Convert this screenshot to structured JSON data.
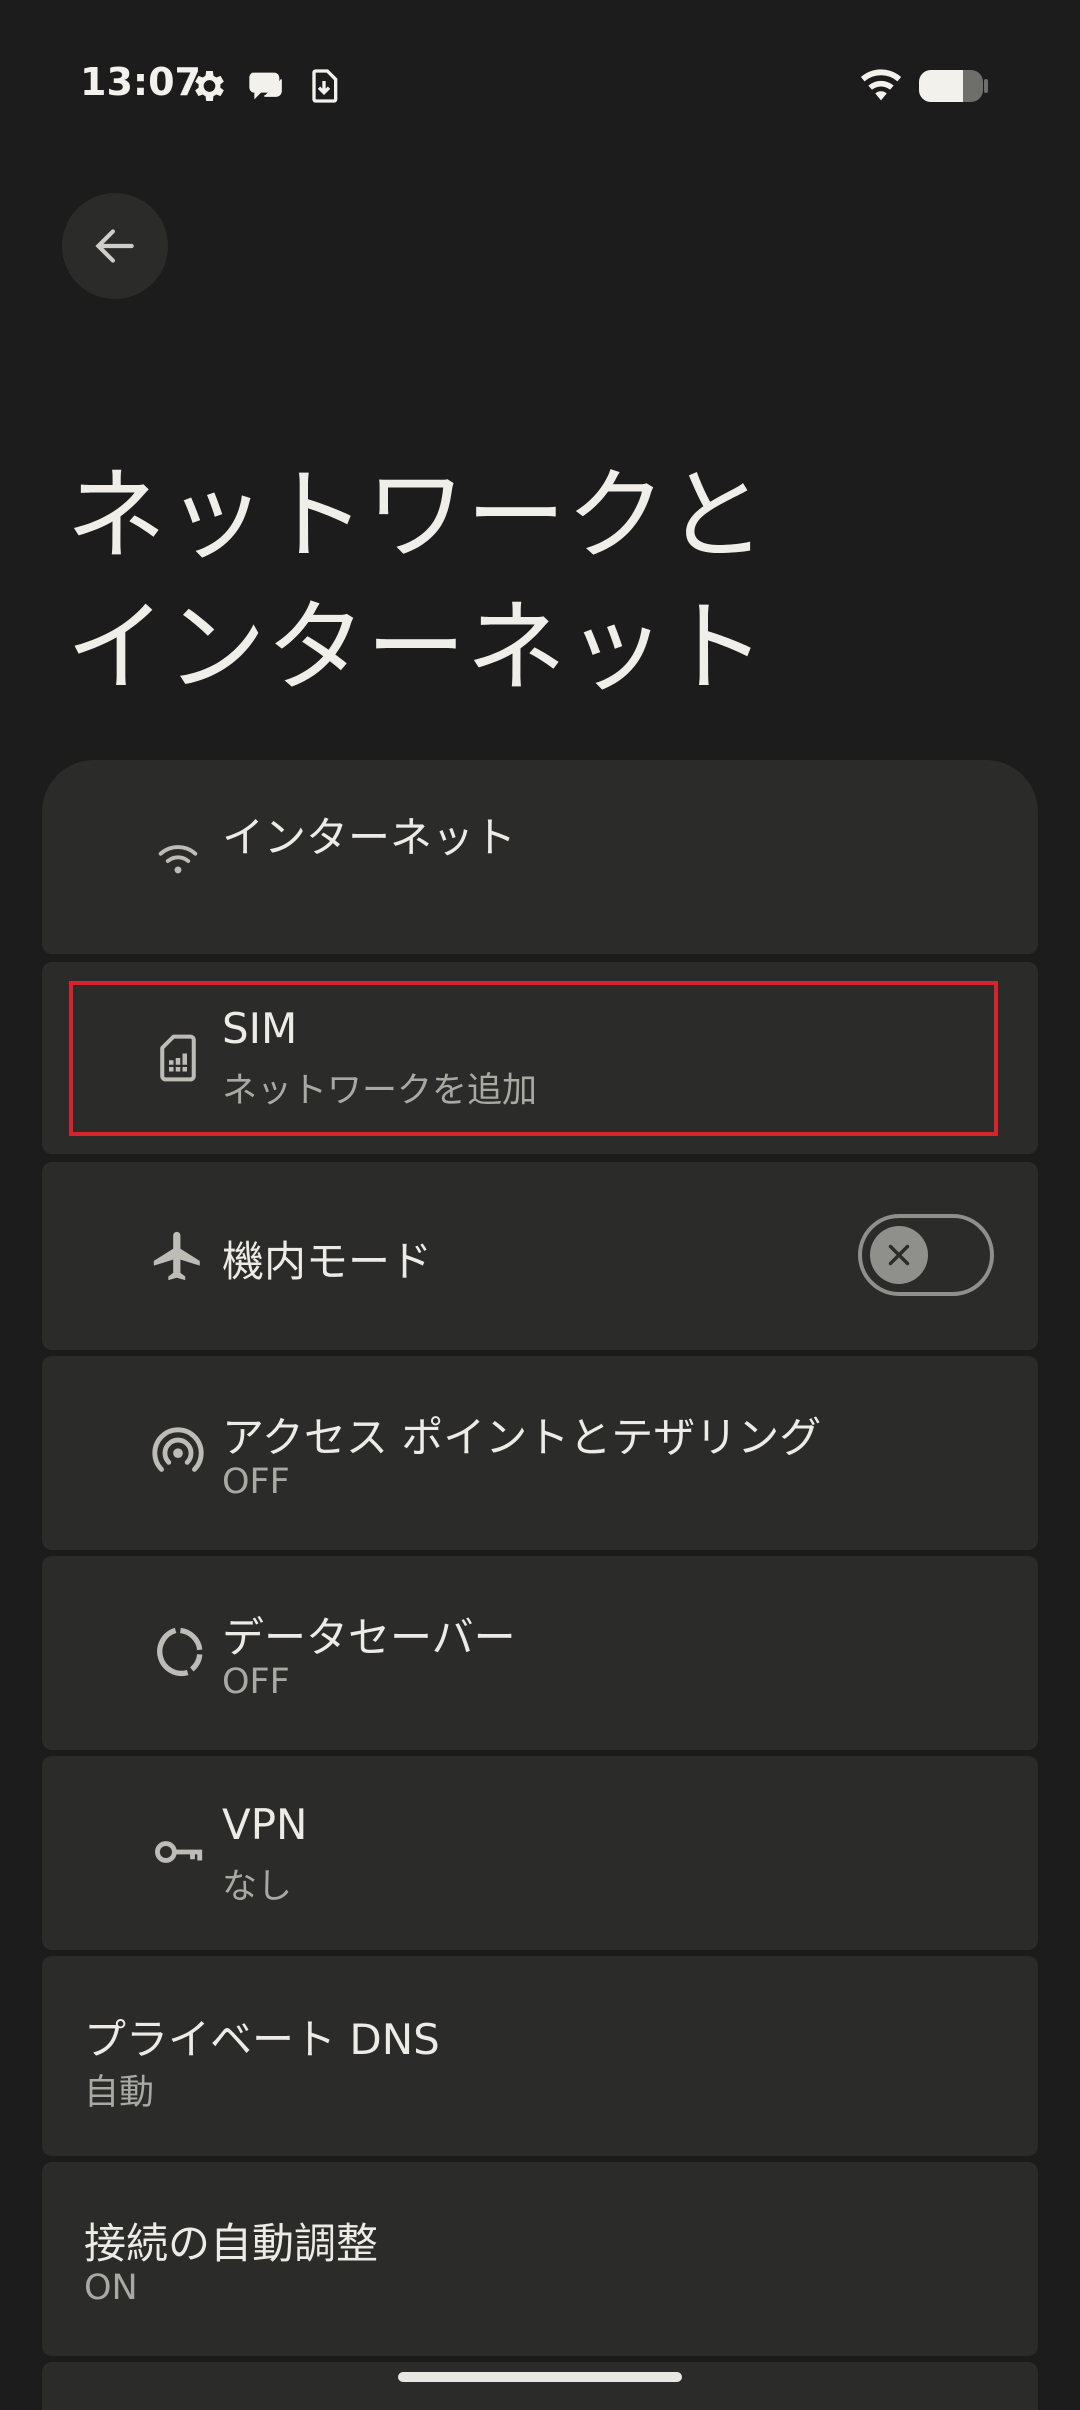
{
  "status_bar": {
    "time": "13:07",
    "icons": [
      "gear-icon",
      "chat-bubble-icon",
      "download-icon",
      "wifi-icon",
      "battery-icon"
    ]
  },
  "header": {
    "back_icon": "arrow-left-icon",
    "title_line1": "ネットワークと",
    "title_line2": "インターネット"
  },
  "items": [
    {
      "id": "internet",
      "title": "インターネット",
      "subtitle": "",
      "icon": "wifi-icon"
    },
    {
      "id": "sim",
      "title": "SIM",
      "subtitle": "ネットワークを追加",
      "icon": "sim-card-icon"
    },
    {
      "id": "airplane",
      "title": "機内モード",
      "subtitle": "",
      "icon": "airplane-icon",
      "toggle": false
    },
    {
      "id": "hotspot",
      "title": "アクセス ポイントとテザリング",
      "subtitle": "OFF",
      "icon": "hotspot-icon"
    },
    {
      "id": "datasaver",
      "title": "データセーバー",
      "subtitle": "OFF",
      "icon": "data-saver-icon"
    },
    {
      "id": "vpn",
      "title": "VPN",
      "subtitle": "なし",
      "icon": "key-icon"
    },
    {
      "id": "private_dns",
      "title": "プライベート DNS",
      "subtitle": "自動"
    },
    {
      "id": "adaptive",
      "title": "接続の自動調整",
      "subtitle": "ON"
    }
  ],
  "colors": {
    "background": "#1b1c1b",
    "card": "#2b2c2a",
    "highlight": "#d6242e"
  }
}
